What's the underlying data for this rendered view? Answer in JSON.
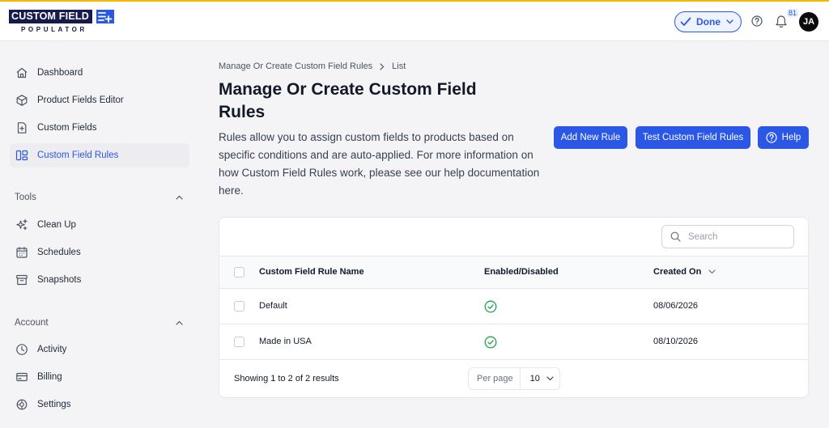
{
  "app": {
    "logo_main": "CUSTOM FIELD",
    "logo_sub": "POPULATOR"
  },
  "topbar": {
    "done_label": "Done",
    "notification_count": "81",
    "avatar_initials": "JA"
  },
  "sidebar": {
    "main_items": [
      {
        "label": "Dashboard",
        "icon": "home-icon"
      },
      {
        "label": "Product Fields Editor",
        "icon": "cube-icon"
      },
      {
        "label": "Custom Fields",
        "icon": "document-plus-icon"
      },
      {
        "label": "Custom Field Rules",
        "icon": "rules-icon",
        "active": true
      }
    ],
    "tools_heading": "Tools",
    "tools_items": [
      {
        "label": "Clean Up",
        "icon": "sparkles-icon"
      },
      {
        "label": "Schedules",
        "icon": "calendar-icon"
      },
      {
        "label": "Snapshots",
        "icon": "archive-icon"
      }
    ],
    "account_heading": "Account",
    "account_items": [
      {
        "label": "Activity",
        "icon": "clock-icon"
      },
      {
        "label": "Billing",
        "icon": "credit-card-icon"
      },
      {
        "label": "Settings",
        "icon": "settings-icon"
      }
    ]
  },
  "main": {
    "breadcrumb": [
      "Manage Or Create Custom Field Rules",
      "List"
    ],
    "title": "Manage Or Create Custom Field Rules",
    "description": "Rules allow you to assign custom fields to products based on specific conditions and are auto-applied. For more information on how Custom Field Rules work, please see our help documentation here.",
    "buttons": {
      "add": "Add New Rule",
      "test": "Test Custom Field Rules",
      "help": "Help"
    }
  },
  "table": {
    "search_placeholder": "Search",
    "columns": [
      "Custom Field Rule Name",
      "Enabled/Disabled",
      "Created On"
    ],
    "rows": [
      {
        "name": "Default",
        "enabled": true,
        "created": "08/06/2026"
      },
      {
        "name": "Made in USA",
        "enabled": true,
        "created": "08/10/2026"
      }
    ],
    "footer": "Showing 1 to 2 of 2 results",
    "per_page_label": "Per page",
    "per_page_value": "10"
  },
  "colors": {
    "accent": "#2b57e6",
    "success": "#22a34a",
    "brand_navy": "#171a4a"
  }
}
